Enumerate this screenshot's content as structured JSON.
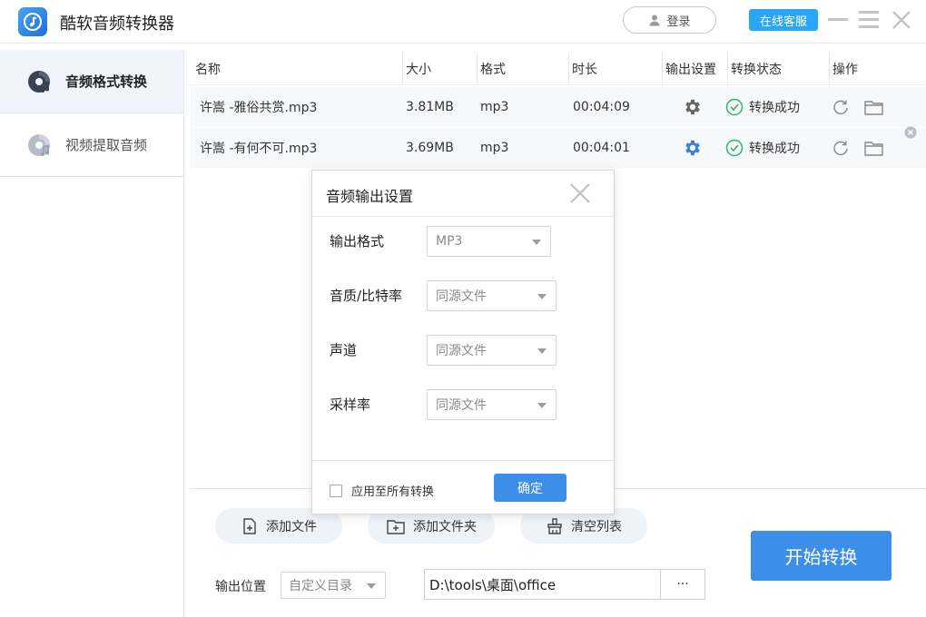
{
  "app": {
    "title": "酷软音频转换器"
  },
  "header": {
    "login_label": "登录",
    "service_label": "在线客服"
  },
  "sidebar": {
    "items": [
      {
        "label": "音频格式转换",
        "icon": "audio-disc-icon",
        "active": true
      },
      {
        "label": "视频提取音频",
        "icon": "video-disc-icon",
        "active": false
      }
    ]
  },
  "table": {
    "columns": [
      "名称",
      "大小",
      "格式",
      "时长",
      "输出设置",
      "转换状态",
      "操作"
    ],
    "rows": [
      {
        "name": "许嵩 -雅俗共赏.mp3",
        "size": "3.81MB",
        "format": "mp3",
        "duration": "00:04:09",
        "status": "转换成功"
      },
      {
        "name": "许嵩 -有何不可.mp3",
        "size": "3.69MB",
        "format": "mp3",
        "duration": "00:04:01",
        "status": "转换成功"
      }
    ]
  },
  "dialog": {
    "title": "音频输出设置",
    "fields": [
      {
        "label": "输出格式",
        "value": "MP3"
      },
      {
        "label": "音质/比特率",
        "value": "同源文件"
      },
      {
        "label": "声道",
        "value": "同源文件"
      },
      {
        "label": "采样率",
        "value": "同源文件"
      }
    ],
    "apply_all_label": "应用至所有转换",
    "confirm_label": "确定"
  },
  "actions": {
    "add_file": "添加文件",
    "add_folder": "添加文件夹",
    "clear_list": "清空列表"
  },
  "output": {
    "label": "输出位置",
    "mode": "自定义目录",
    "path": "D:\\tools\\桌面\\office",
    "browse_label": "···"
  },
  "start_label": "开始转换",
  "colors": {
    "accent": "#3d8ee8",
    "service": "#2aa6f6",
    "success": "#2fb36d"
  }
}
